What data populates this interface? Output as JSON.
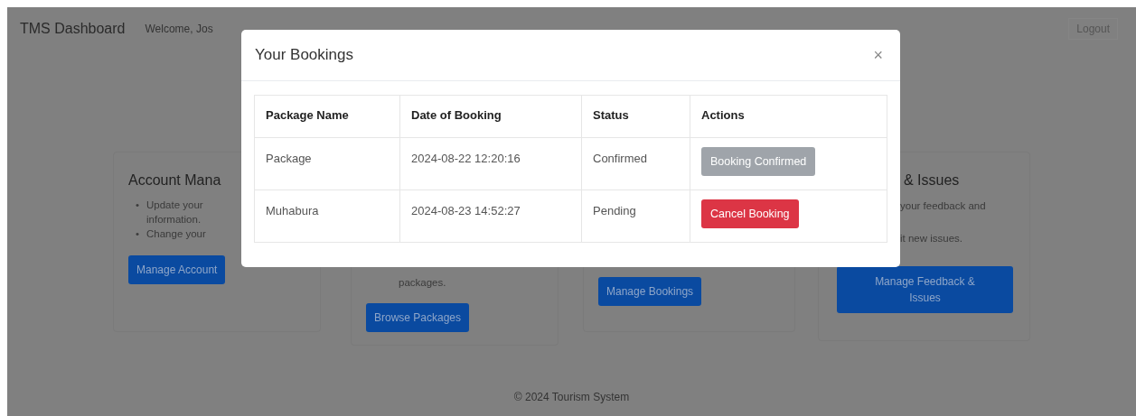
{
  "navbar": {
    "brand": "TMS Dashboard",
    "welcome": "Welcome, Jos",
    "logout": "Logout"
  },
  "cards": [
    {
      "title": "Account Mana",
      "bullets": [
        {
          "marker": "•",
          "text": "Update your information."
        },
        {
          "marker": "•",
          "text": "Change your"
        }
      ],
      "button": "Manage Account"
    },
    {
      "lines": [
        "packages."
      ],
      "button": "Browse Packages"
    },
    {
      "button": "Manage Bookings"
    },
    {
      "title": "& Issues",
      "lines": [
        "your feedback and",
        "it new issues."
      ],
      "button": "Manage Feedback & Issues"
    }
  ],
  "footer": "© 2024 Tourism System",
  "modal": {
    "title": "Your Bookings",
    "close": "×",
    "table": {
      "columns": [
        "Package Name",
        "Date of Booking",
        "Status",
        "Actions"
      ],
      "rows": [
        {
          "package": "Package",
          "date": "2024-08-22 12:20:16",
          "status": "Confirmed",
          "action": {
            "label": "Booking Confirmed",
            "kind": "secondary",
            "disabled": true
          }
        },
        {
          "package": "Muhabura",
          "date": "2024-08-23 14:52:27",
          "status": "Pending",
          "action": {
            "label": "Cancel Booking",
            "kind": "danger",
            "disabled": false
          }
        }
      ]
    }
  }
}
